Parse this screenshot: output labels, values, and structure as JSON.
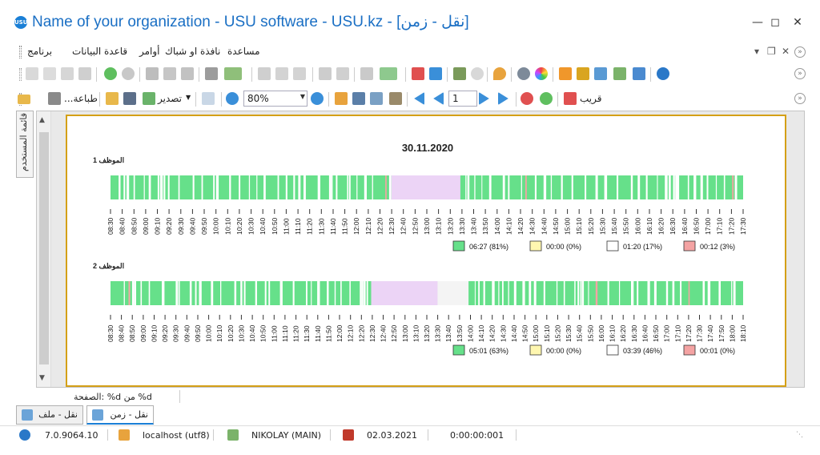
{
  "app": {
    "title": "Name of your organization - USU software - USU.kz - [نقل - زمن]",
    "icon": "usu-logo-icon"
  },
  "menu": {
    "items": [
      "برنامج",
      "قاعدة البيانات",
      "أوامر",
      "نافذة او شباك",
      "مساعدة"
    ]
  },
  "toolbar2": {
    "print_label": "طباعة...",
    "export_label": "تصدير",
    "zoom_value": "80%",
    "page_value": "1",
    "close_label": "قريب"
  },
  "sidebar": {
    "tab_label": "قائمة المستخدم"
  },
  "report": {
    "date": "30.11.2020",
    "employees": [
      {
        "label": "الموظف 1",
        "ticks": [
          "08:30",
          "08:40",
          "08:50",
          "09:00",
          "09:10",
          "09:20",
          "09:30",
          "09:40",
          "09:50",
          "10:00",
          "10:10",
          "10:20",
          "10:30",
          "10:40",
          "10:50",
          "11:00",
          "11:10",
          "11:20",
          "11:30",
          "11:40",
          "11:50",
          "12:00",
          "12:10",
          "12:20",
          "12:30",
          "12:40",
          "12:50",
          "13:00",
          "13:10",
          "13:20",
          "13:30",
          "13:40",
          "13:50",
          "14:00",
          "14:10",
          "14:20",
          "14:30",
          "14:40",
          "14:50",
          "15:00",
          "15:10",
          "15:20",
          "15:30",
          "15:40",
          "15:50",
          "16:00",
          "16:10",
          "16:20",
          "16:30",
          "16:40",
          "16:50",
          "17:00",
          "17:10",
          "17:20",
          "17:30"
        ],
        "legend": [
          "06:27 (81%)",
          "00:00 (0%)",
          "01:20 (17%)",
          "00:12 (3%)"
        ]
      },
      {
        "label": "الموظف 2",
        "ticks": [
          "08:30",
          "08:40",
          "08:50",
          "09:00",
          "09:10",
          "09:20",
          "09:30",
          "09:40",
          "09:50",
          "10:00",
          "10:10",
          "10:20",
          "10:30",
          "10:40",
          "10:50",
          "11:00",
          "11:10",
          "11:20",
          "11:30",
          "11:40",
          "11:50",
          "12:00",
          "12:10",
          "12:20",
          "12:30",
          "12:40",
          "12:50",
          "13:00",
          "13:10",
          "13:20",
          "13:30",
          "13:40",
          "13:50",
          "14:00",
          "14:10",
          "14:20",
          "14:30",
          "14:40",
          "14:50",
          "15:00",
          "15:10",
          "15:20",
          "15:30",
          "15:40",
          "15:50",
          "16:00",
          "16:10",
          "16:20",
          "16:30",
          "16:40",
          "16:50",
          "17:00",
          "17:10",
          "17:20",
          "17:30",
          "17:40",
          "17:50",
          "18:00",
          "18:10"
        ],
        "legend": [
          "05:01 (63%)",
          "00:00 (0%)",
          "03:39 (46%)",
          "00:01 (0%)"
        ]
      }
    ],
    "legend_colors": [
      "#66e08a",
      "#fff7b0",
      "#ffffff",
      "#f4a3a3"
    ],
    "colors": {
      "active": "#66e08a",
      "break": "#ecd4f6",
      "idle": "#f4f4f4",
      "warn": "#f4a3a3"
    }
  },
  "page_indicator": "الصفحة: %d من %d",
  "doc_tabs": [
    {
      "label": "نقل - ملف",
      "active": false
    },
    {
      "label": "نقل - زمن",
      "active": true
    }
  ],
  "status": {
    "version": "7.0.9064.10",
    "database": "localhost (utf8)",
    "user": "NIKOLAY (MAIN)",
    "date": "02.03.2021",
    "timer": "0:00:00:001"
  }
}
